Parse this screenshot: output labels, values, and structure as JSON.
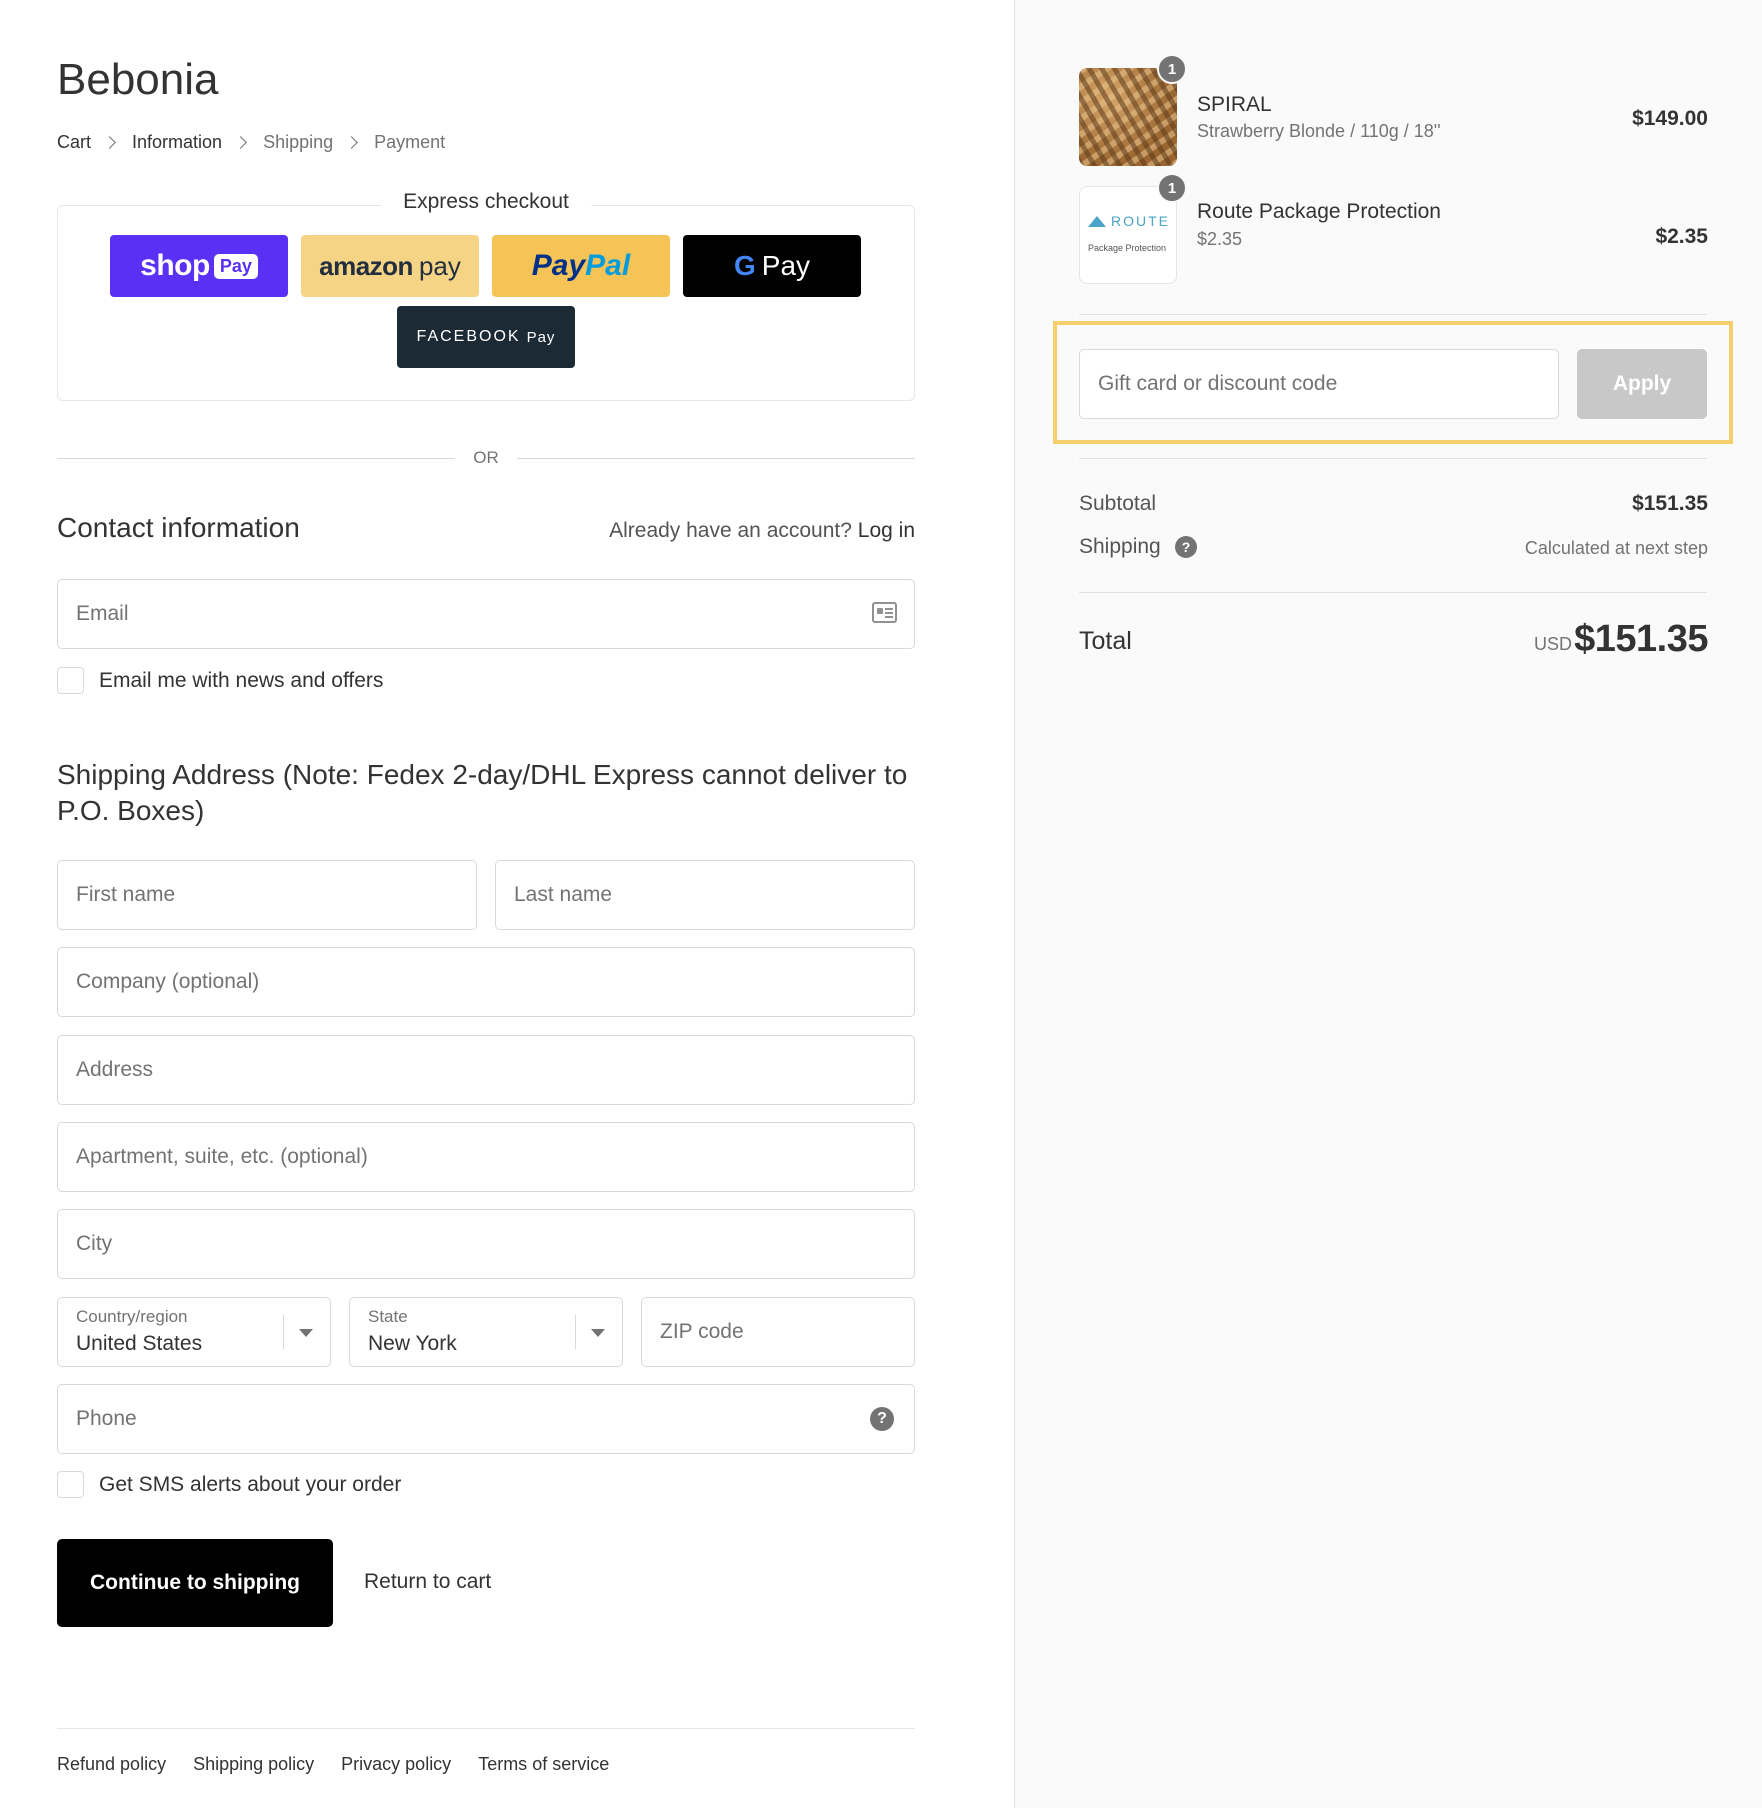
{
  "store": {
    "name": "Bebonia"
  },
  "breadcrumb": {
    "items": [
      {
        "label": "Cart"
      },
      {
        "label": "Information"
      },
      {
        "label": "Shipping"
      },
      {
        "label": "Payment"
      }
    ],
    "current": "Information"
  },
  "express": {
    "title": "Express checkout",
    "shop_pay": {
      "word": "shop",
      "badge": "Pay"
    },
    "amazon_pay": {
      "brand": "amazon",
      "suffix": "pay"
    },
    "paypal": {
      "part1": "Pay",
      "part2": "Pal"
    },
    "google_pay": {
      "g": "G",
      "label": "Pay"
    },
    "facebook_pay": {
      "brand": "FACEBOOK",
      "suffix": "Pay"
    }
  },
  "or_label": "OR",
  "contact": {
    "title": "Contact information",
    "account_prompt": "Already have an account?",
    "login_label": "Log in",
    "email_placeholder": "Email",
    "news_label": "Email me with news and offers",
    "news_checked": false
  },
  "shipping": {
    "title": "Shipping Address (Note: Fedex 2-day/DHL Express cannot deliver to P.O. Boxes)",
    "first_name_placeholder": "First name",
    "last_name_placeholder": "Last name",
    "company_placeholder": "Company (optional)",
    "address_placeholder": "Address",
    "apartment_placeholder": "Apartment, suite, etc. (optional)",
    "city_placeholder": "City",
    "country": {
      "label": "Country/region",
      "value": "United States"
    },
    "state": {
      "label": "State",
      "value": "New York"
    },
    "zip_placeholder": "ZIP code",
    "phone_placeholder": "Phone",
    "sms_label": "Get SMS alerts about your order",
    "sms_checked": false
  },
  "actions": {
    "continue_label": "Continue to shipping",
    "return_label": "Return to cart"
  },
  "footer": {
    "links": [
      "Refund policy",
      "Shipping policy",
      "Privacy policy",
      "Terms of service"
    ]
  },
  "order": {
    "items": [
      {
        "name": "SPIRAL",
        "variant": "Strawberry Blonde / 110g / 18''",
        "price": "$149.00",
        "quantity": "1"
      },
      {
        "name": "Route Package Protection",
        "variant": "$2.35",
        "price": "$2.35",
        "quantity": "1",
        "logo_text": "ROUTE",
        "logo_sub": "Package Protection"
      }
    ],
    "discount_placeholder": "Gift card or discount code",
    "apply_label": "Apply",
    "subtotal_label": "Subtotal",
    "subtotal_value": "$151.35",
    "shipping_label": "Shipping",
    "shipping_value": "Calculated at next step",
    "total_label": "Total",
    "currency": "USD",
    "total_value": "$151.35"
  },
  "colors": {
    "shop_pay": "#5a31f4",
    "amazon_pay": "#f5d485",
    "paypal": "#f6c456",
    "google_pay": "#000000",
    "facebook_pay": "#1c2a35",
    "highlight": "#f5cf6d",
    "apply_disabled": "#c8c8c8"
  },
  "icons": {
    "contact_card": "contact-card-icon",
    "help": "question-circle-icon",
    "breadcrumb_separator": "chevron-right-icon"
  }
}
